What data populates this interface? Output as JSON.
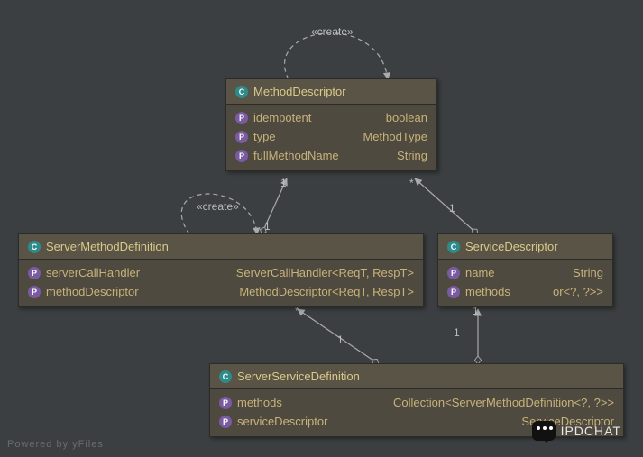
{
  "classes": {
    "methodDescriptor": {
      "title": "MethodDescriptor",
      "props": [
        {
          "name": "idempotent",
          "type": "boolean"
        },
        {
          "name": "type",
          "type": "MethodType"
        },
        {
          "name": "fullMethodName",
          "type": "String"
        }
      ]
    },
    "serverMethodDefinition": {
      "title": "ServerMethodDefinition",
      "props": [
        {
          "name": "serverCallHandler",
          "type": "ServerCallHandler<ReqT, RespT>"
        },
        {
          "name": "methodDescriptor",
          "type": "MethodDescriptor<ReqT, RespT>"
        }
      ]
    },
    "serviceDescriptor": {
      "title": "ServiceDescriptor",
      "props": [
        {
          "name": "name",
          "type": "String"
        },
        {
          "name": "methods",
          "type": "or<?, ?>>"
        }
      ]
    },
    "serverServiceDefinition": {
      "title": "ServerServiceDefinition",
      "props": [
        {
          "name": "methods",
          "type": "Collection<ServerMethodDefinition<?, ?>>"
        },
        {
          "name": "serviceDescriptor",
          "type": "ServiceDescriptor"
        }
      ]
    }
  },
  "edges": {
    "createSelfMD": {
      "label": "«create»"
    },
    "createSelfSMD": {
      "label": "«create»"
    },
    "md_smd": {
      "src_mult": "1",
      "dst_mult": "1"
    },
    "md_sd": {
      "src_mult": "*",
      "dst_mult": "1"
    },
    "smd_ssd": {
      "src_mult": "*",
      "dst_mult": "1"
    },
    "sd_ssd": {
      "src_mult": "1",
      "dst_mult": "1"
    }
  },
  "footer": "Powered by yFiles",
  "watermark": "IPDCHAT"
}
